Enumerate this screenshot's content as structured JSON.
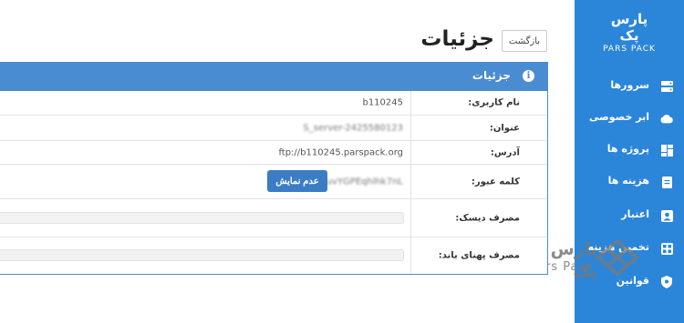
{
  "sidebar": {
    "logo": {
      "fa": "پارس پک",
      "en": "PARS PACK"
    },
    "items": [
      {
        "label": "سرورها",
        "icon": "server-icon"
      },
      {
        "label": "ابر خصوصی",
        "icon": "cloud-icon"
      },
      {
        "label": "پروژه ها",
        "icon": "dashboard-icon"
      },
      {
        "label": "هزینه ها",
        "icon": "invoice-icon"
      },
      {
        "label": "اعتبار",
        "icon": "user-card-icon"
      },
      {
        "label": "تخمین هزینه",
        "icon": "calculator-icon"
      },
      {
        "label": "قوانین",
        "icon": "shield-icon"
      }
    ],
    "color": "#2b86d9"
  },
  "watermark": {
    "fa": "پارس پک",
    "en": "Pars Pack"
  },
  "header": {
    "title": "جزئیات",
    "back_label": "بازگشت"
  },
  "panel": {
    "title": "جزئیات",
    "color": "#4a8cd1",
    "rows": [
      {
        "label": "نام کاربری:",
        "value": "b110245"
      },
      {
        "label": "عنوان:",
        "value": "S_server-2425580123"
      },
      {
        "label": "آدرس:",
        "value": "ftp://b110245.parspack.org"
      },
      {
        "label": "کلمه عبور:",
        "value": "uvYGPEqhlhk7nL",
        "button": "عدم نمایش"
      },
      {
        "label": "مصرف دیسک:"
      },
      {
        "label": "مصرف پهنای باند:"
      }
    ]
  }
}
